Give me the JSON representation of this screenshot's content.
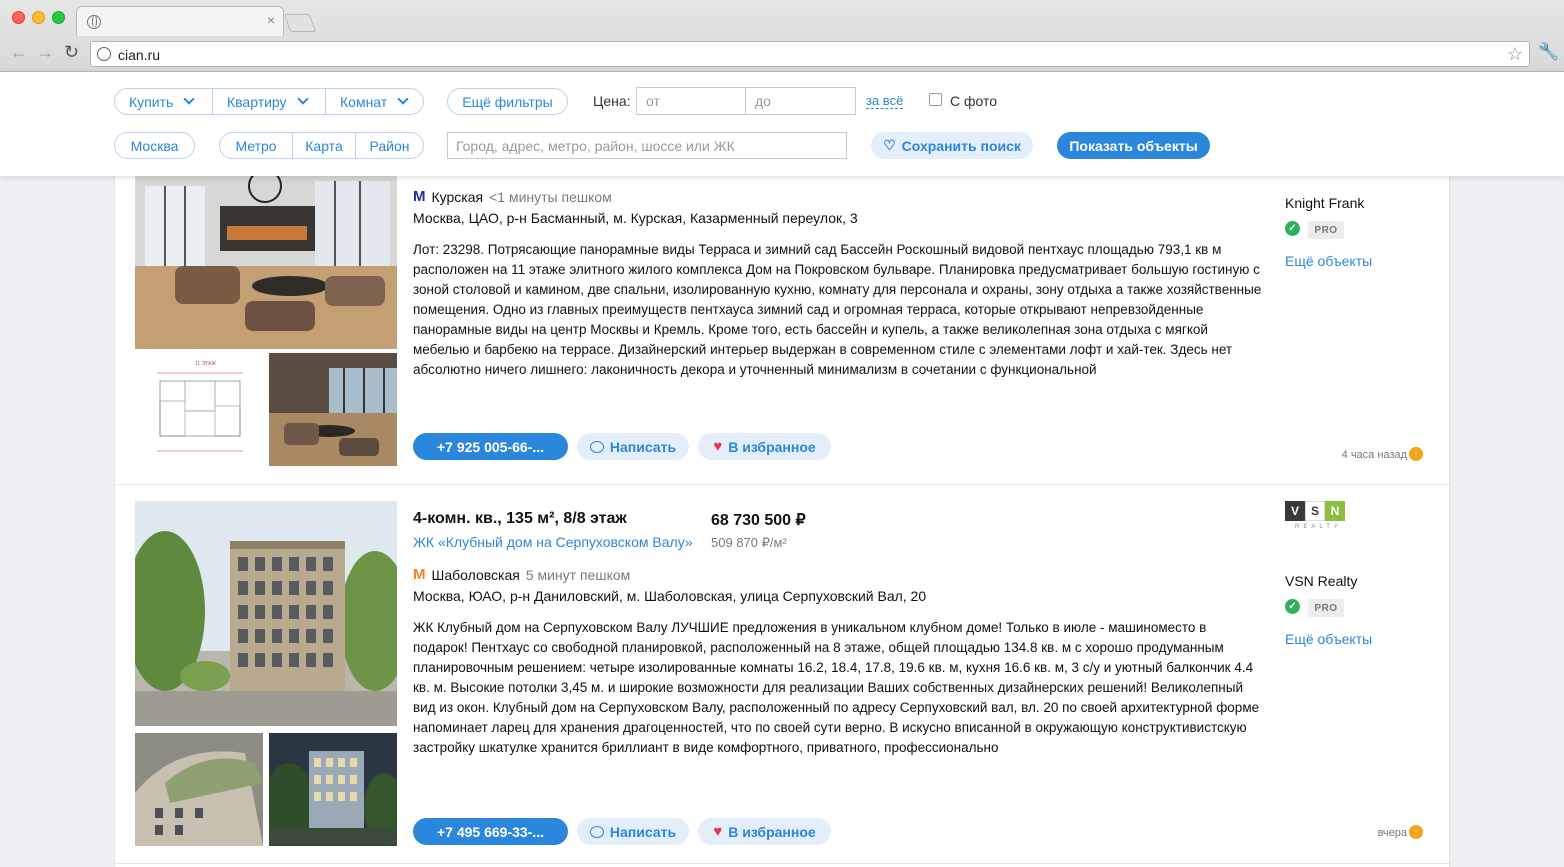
{
  "browser": {
    "url": "cian.ru",
    "tab_close": "×"
  },
  "filters": {
    "deal_type": "Купить",
    "property_type": "Квартиру",
    "rooms": "Комнат",
    "more_filters": "Ещё фильтры",
    "price_label": "Цена:",
    "price_from_placeholder": "от",
    "price_to_placeholder": "до",
    "price_scope": "за всё",
    "with_photo": "С фото",
    "city": "Москва",
    "geo_tabs": [
      "Метро",
      "Карта",
      "Район"
    ],
    "search_placeholder": "Город, адрес, метро, район, шоссе или ЖК",
    "save_search": "Сохранить поиск",
    "show_objects": "Показать объекты"
  },
  "listings": [
    {
      "metro_color": "#1b2fa0",
      "metro": "Курская",
      "walk": "<1 минуты пешком",
      "address": "Москва, ЦАО, р-н Басманный, м. Курская, Казарменный переулок, 3",
      "description": "Лот: 23298. Потрясающие панорамные виды Терраса и зимний сад Бассейн Роскошный видовой пентхаус площадью 793,1 кв м расположен на 11 этаже элитного жилого комплекса Дом на Покровском бульваре. Планировка предусматривает большую гостиную с зоной столовой и камином, две спальни, изолированную кухню, комнату для персонала и охраны, зону отдыха а также хозяйственные помещения. Одно из главных преимуществ пентхауса зимний сад и огромная терраса, которые открывают непревзойденные панорамные виды на центр Москвы и Кремль. Кроме того, есть бассейн и купель, а также великолепная зона отдыха с мягкой мебелью и барбекю на террасе. Дизайнерский интерьер выдержан в современном стиле с элементами лофт и хай-тек. Здесь нет абсолютно ничего лишнего: лаконичность декора и уточненный минимализм в сочетании с функциональной",
      "phone": "+7 925 005-66-...",
      "write": "Написать",
      "favorite": "В избранное",
      "agency": "Knight Frank",
      "pro": "PRO",
      "more": "Ещё объекты",
      "time": "4 часа назад",
      "photo_caption": "11 ЭТАЖ"
    },
    {
      "title": "4-комн. кв., 135 м², 8/8 этаж",
      "jk": "ЖК «Клубный дом на Серпуховском Валу»",
      "price": "68 730 500 ₽",
      "price_per_m2": "509 870 ₽/м²",
      "metro_color": "#f58220",
      "metro": "Шаболовская",
      "walk": "5 минут пешком",
      "address": "Москва, ЮАО, р-н Даниловский, м. Шаболовская, улица Серпуховский Вал, 20",
      "description": "ЖК Клубный дом на Серпуховском Валу ЛУЧШИЕ предложения в уникальном клубном доме! Только в июле - машиноместо в подарок! Пентхаус со свободной планировкой, расположенный на 8 этаже, общей площадью 134.8 кв. м с хорошо продуманным планировочным решением: четыре изолированные комнаты 16.2, 18.4, 17.8, 19.6 кв. м, кухня 16.6 кв. м, 3 с/у и уютный балкончик 4.4 кв. м. Высокие потолки 3,45 м. и широкие возможности для реализации Ваших собственных дизайнерских решений! Великолепный вид из окон. Клубный дом на Серпуховском Валу, расположенный по адресу Серпуховский вал, вл. 20 по своей архитектурной форме напоминает ларец для хранения драгоценностей, что по своей сути верно. В искусно вписанной в окружающую конструктивистскую застройку шкатулке хранится бриллиант в виде комфортного, приватного, профессионально",
      "phone": "+7 495 669-33-...",
      "write": "Написать",
      "favorite": "В избранное",
      "agency": "VSN Realty",
      "agency_logo": [
        "V",
        "S",
        "N"
      ],
      "agency_logo_sub": "REALTY",
      "pro": "PRO",
      "more": "Ещё объекты",
      "time": "вчера"
    }
  ],
  "glyphs": {
    "metro": "M",
    "check": "✓",
    "up": "↑",
    "heart": "♥"
  }
}
